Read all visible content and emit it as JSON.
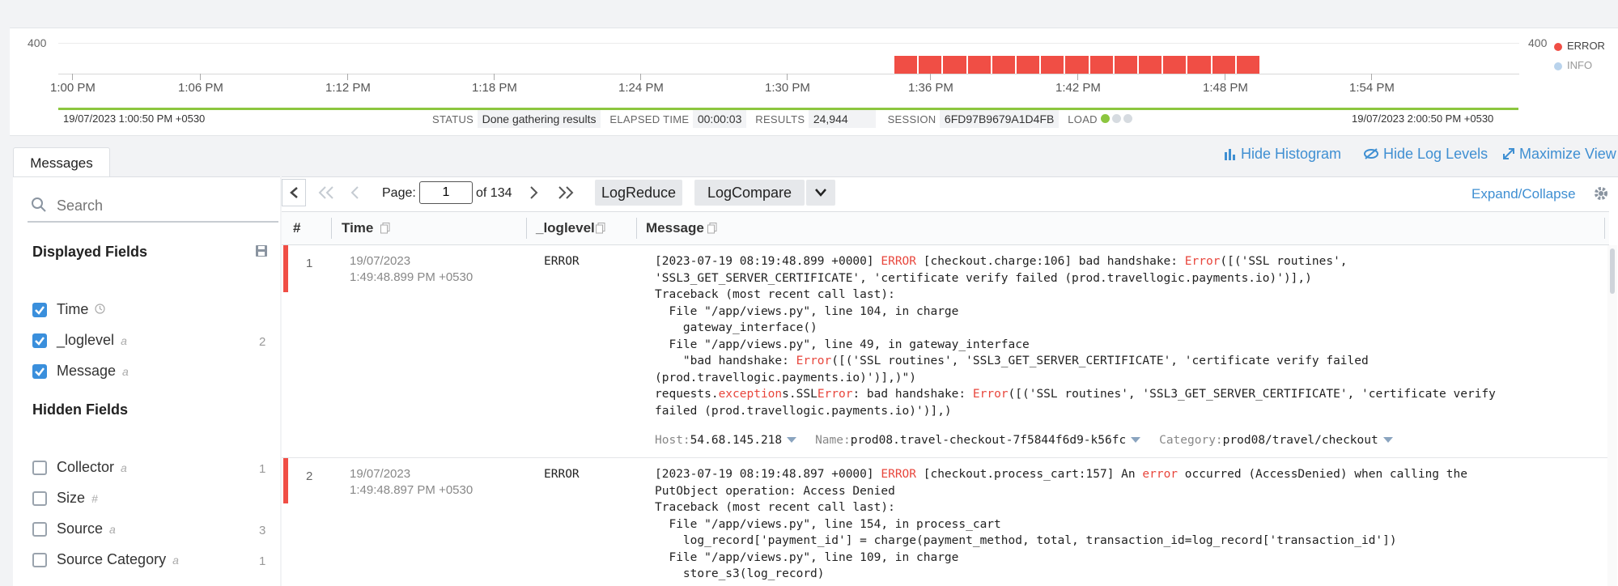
{
  "histogram": {
    "y_max_left": "400",
    "y_max_right": "400",
    "ticks": [
      "1:00 PM",
      "1:06 PM",
      "1:12 PM",
      "1:18 PM",
      "1:24 PM",
      "1:30 PM",
      "1:36 PM",
      "1:42 PM",
      "1:48 PM",
      "1:54 PM"
    ],
    "legend": [
      {
        "label": "ERROR",
        "color": "#f04e45"
      },
      {
        "label": "INFO",
        "color": "#b9d3ec"
      }
    ],
    "bars_level": "ERROR",
    "bar_count": 15,
    "range_start": "19/07/2023 1:00:50 PM +0530",
    "range_end": "19/07/2023 2:00:50 PM +0530"
  },
  "status": {
    "status_label": "STATUS",
    "status_value": "Done gathering results",
    "elapsed_label": "ELAPSED TIME",
    "elapsed_value": "00:00:03",
    "results_label": "RESULTS",
    "results_value": "24,944",
    "session_label": "SESSION",
    "session_value": "6FD97B9679A1D4FB",
    "load_label": "LOAD"
  },
  "tabs": {
    "messages": "Messages"
  },
  "actions": {
    "hide_histogram": "Hide Histogram",
    "hide_log_levels": "Hide Log Levels",
    "maximize_view": "Maximize View"
  },
  "sidebar": {
    "search_placeholder": "Search",
    "displayed_title": "Displayed Fields",
    "hidden_title": "Hidden Fields",
    "displayed": [
      {
        "name": "Time",
        "type": "",
        "count": ""
      },
      {
        "name": "_loglevel",
        "type": "a",
        "count": "2"
      },
      {
        "name": "Message",
        "type": "a",
        "count": ""
      }
    ],
    "hidden": [
      {
        "name": "Collector",
        "type": "a",
        "count": "1"
      },
      {
        "name": "Size",
        "type": "#",
        "count": ""
      },
      {
        "name": "Source",
        "type": "a",
        "count": "3"
      },
      {
        "name": "Source Category",
        "type": "a",
        "count": "1"
      }
    ]
  },
  "pager": {
    "page_label": "Page:",
    "page_value": "1",
    "of_label": "of 134"
  },
  "toolbar": {
    "logreduce": "LogReduce",
    "logcompare": "LogCompare",
    "expand_collapse": "Expand/Collapse"
  },
  "columns": {
    "num": "#",
    "time": "Time",
    "loglevel": "_loglevel",
    "message": "Message"
  },
  "rows": [
    {
      "num": "1",
      "date": "19/07/2023",
      "time": "1:49:48.899 PM +0530",
      "level": "ERROR",
      "lines": [
        [
          "[2023-07-19 08:19:48.899 +0000] ",
          "ERROR",
          " [checkout.charge:106] bad handshake: ",
          "Error",
          "([('SSL routines',"
        ],
        [
          "'SSL3_GET_SERVER_CERTIFICATE', 'certificate verify failed (prod.travellogic.payments.io)')],)"
        ],
        [
          "Traceback (most recent call last):"
        ],
        [
          "  File \"/app/views.py\", line 104, in charge"
        ],
        [
          "    gateway_interface()"
        ],
        [
          "  File \"/app/views.py\", line 49, in gateway_interface"
        ],
        [
          "    \"bad handshake: ",
          "Error",
          "([('SSL routines', 'SSL3_GET_SERVER_CERTIFICATE', 'certificate verify failed"
        ],
        [
          "(prod.travellogic.payments.io)')],)\")"
        ],
        [
          "requests.",
          "exception",
          "s.SSL",
          "Error",
          ": bad handshake: ",
          "Error",
          "([('SSL routines', 'SSL3_GET_SERVER_CERTIFICATE', 'certificate verify"
        ],
        [
          "failed (prod.travellogic.payments.io)')],)"
        ]
      ],
      "host_label": "Host:",
      "host": "54.68.145.218",
      "name_label": "Name:",
      "name": "prod08.travel-checkout-7f5844f6d9-k56fc",
      "category_label": "Category:",
      "category": "prod08/travel/checkout"
    },
    {
      "num": "2",
      "date": "19/07/2023",
      "time": "1:49:48.897 PM +0530",
      "level": "ERROR",
      "lines": [
        [
          "[2023-07-19 08:19:48.897 +0000] ",
          "ERROR",
          " [checkout.process_cart:157] An ",
          "error",
          " occurred (AccessDenied) when calling the"
        ],
        [
          "PutObject operation: Access Denied"
        ],
        [
          "Traceback (most recent call last):"
        ],
        [
          "  File \"/app/views.py\", line 154, in process_cart"
        ],
        [
          "    log_record['payment_id'] = charge(payment_method, total, transaction_id=log_record['transaction_id'])"
        ],
        [
          "  File \"/app/views.py\", line 109, in charge"
        ],
        [
          "    store_s3(log_record)"
        ]
      ]
    }
  ]
}
